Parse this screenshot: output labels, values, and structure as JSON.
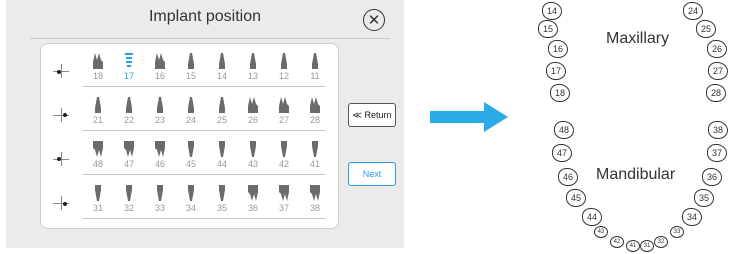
{
  "dialog": {
    "title": "Implant position",
    "close_symbol": "✕"
  },
  "rows": [
    {
      "quadrant": "upper-right",
      "teeth": [
        "18",
        "17",
        "16",
        "15",
        "14",
        "13",
        "12",
        "11"
      ],
      "selected": "17"
    },
    {
      "quadrant": "upper-left",
      "teeth": [
        "21",
        "22",
        "23",
        "24",
        "25",
        "26",
        "27",
        "28"
      ],
      "selected": null
    },
    {
      "quadrant": "lower-right",
      "teeth": [
        "48",
        "47",
        "46",
        "45",
        "44",
        "43",
        "42",
        "41"
      ],
      "selected": null
    },
    {
      "quadrant": "lower-left",
      "teeth": [
        "31",
        "32",
        "33",
        "34",
        "35",
        "36",
        "37",
        "38"
      ],
      "selected": null
    }
  ],
  "buttons": {
    "return_label": "≪ Return",
    "next_label": "Next"
  },
  "chart": {
    "maxillary_label": "Maxillary",
    "mandibular_label": "Mandibular",
    "upper_left_numbers": [
      "14",
      "15",
      "16",
      "17",
      "18"
    ],
    "upper_right_numbers": [
      "24",
      "25",
      "26",
      "27",
      "28"
    ],
    "lower_left_numbers": [
      "48",
      "47",
      "46",
      "45",
      "44",
      "43",
      "42",
      "41"
    ],
    "lower_right_numbers": [
      "38",
      "37",
      "36",
      "35",
      "34",
      "33",
      "32",
      "31"
    ]
  },
  "colors": {
    "accent": "#2a9fe0",
    "arrow": "#2aaae6",
    "panel": "#ebebeb"
  },
  "icons": {
    "close": "close-circle-icon",
    "arrow": "right-arrow-icon",
    "tooth": "tooth-icon",
    "quadrant": "quadrant-marker-icon"
  }
}
